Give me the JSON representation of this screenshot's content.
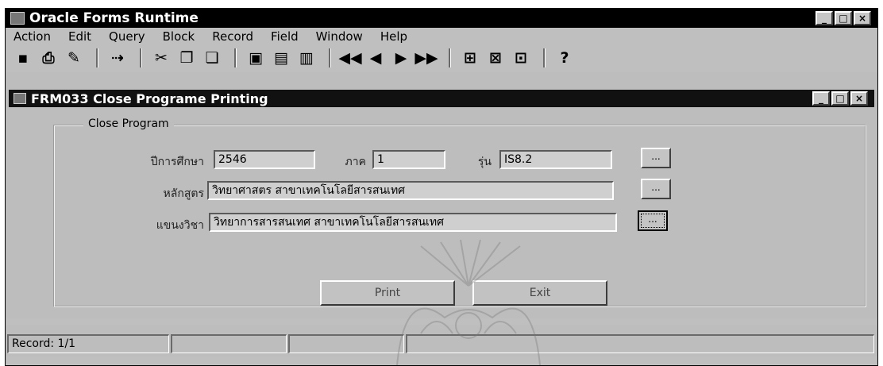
{
  "window": {
    "title": "Oracle Forms Runtime"
  },
  "menu": [
    "Action",
    "Edit",
    "Query",
    "Block",
    "Record",
    "Field",
    "Window",
    "Help"
  ],
  "toolbar": {
    "icons": [
      "save-icon",
      "print-icon",
      "exit-icon",
      "clear-icon",
      "cut-icon",
      "copy-icon",
      "paste-icon",
      "enter-query-icon",
      "execute-query-icon",
      "cancel-query-icon",
      "first-record-icon",
      "previous-record-icon",
      "next-record-icon",
      "last-record-icon",
      "insert-record-icon",
      "delete-record-icon",
      "lock-record-icon",
      "help-icon"
    ]
  },
  "form": {
    "title": "FRM033 Close Programe Printing",
    "group_label": "Close Program",
    "year_label": "ปีการศึกษา",
    "year_value": "2546",
    "term_label": "ภาค",
    "term_value": "1",
    "batch_label": "รุ่น",
    "batch_value": "IS8.2",
    "curriculum_label": "หลักสูตร",
    "curriculum_value": "วิทยาศาสตร สาขาเทคโนโลยีสารสนเทศ",
    "major_label": "แขนงวิชา",
    "major_value": "วิทยาการสารสนเทศ สาขาเทคโนโลยีสารสนเทศ",
    "lov_label": "...",
    "print_label": "Print",
    "exit_label": "Exit"
  },
  "status": {
    "record": "Record: 1/1"
  }
}
